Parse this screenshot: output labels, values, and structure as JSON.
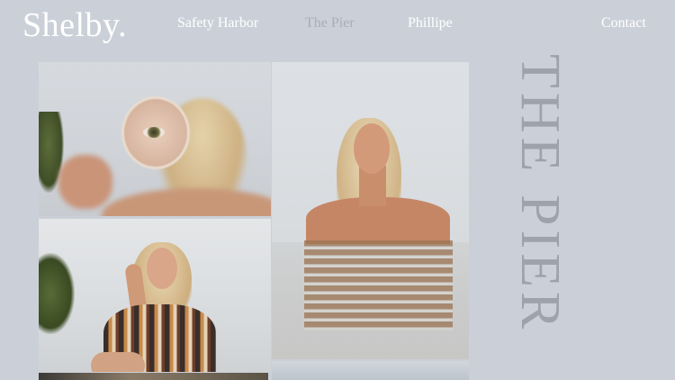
{
  "brand": {
    "logo": "Shelby."
  },
  "nav": {
    "items": [
      {
        "label": "Safety Harbor",
        "active": false
      },
      {
        "label": "The Pier",
        "active": true
      },
      {
        "label": "Phillipe",
        "active": false
      },
      {
        "label": "Contact",
        "active": false
      }
    ]
  },
  "page": {
    "title": "THE PIER"
  },
  "colors": {
    "background": "#cbd0d8",
    "text": "#ffffff",
    "active_nav": "#a8aeb7",
    "title": "#9ea3ab"
  },
  "gallery": {
    "photos": [
      {
        "name": "magnifying-glass-portrait"
      },
      {
        "name": "water-portrait"
      },
      {
        "name": "seated-portrait"
      }
    ]
  }
}
